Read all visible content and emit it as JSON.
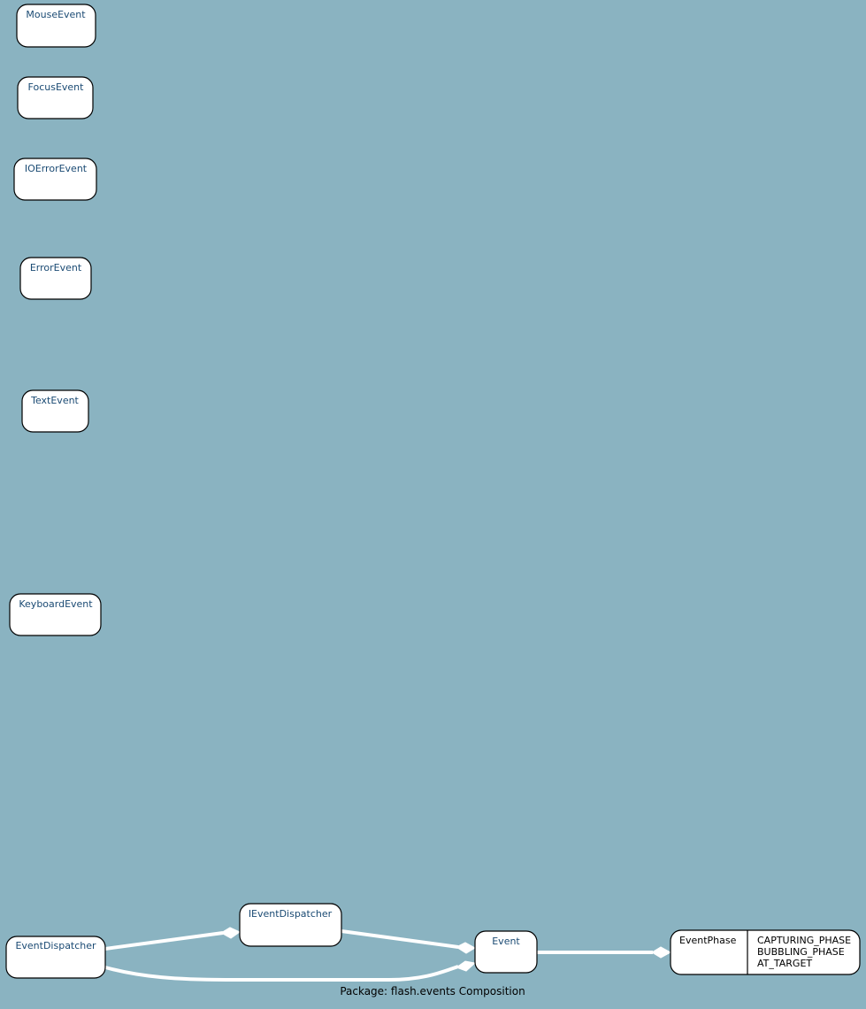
{
  "colors": {
    "background": "#8ab3c1",
    "node_fill": "#ffffff",
    "node_stroke": "#000000",
    "link_text": "#1a4a73",
    "edge": "#ffffff"
  },
  "nodes": {
    "mouse_event": "MouseEvent",
    "focus_event": "FocusEvent",
    "ioerror_event": "IOErrorEvent",
    "error_event": "ErrorEvent",
    "text_event": "TextEvent",
    "keyboard_event": "KeyboardEvent",
    "event_dispatcher": "EventDispatcher",
    "ievent_dispatcher": "IEventDispatcher",
    "event": "Event",
    "event_phase": {
      "name": "EventPhase",
      "fields": [
        "CAPTURING_PHASE",
        "BUBBLING_PHASE",
        "AT_TARGET"
      ]
    }
  },
  "caption": "Package: flash.events Composition"
}
